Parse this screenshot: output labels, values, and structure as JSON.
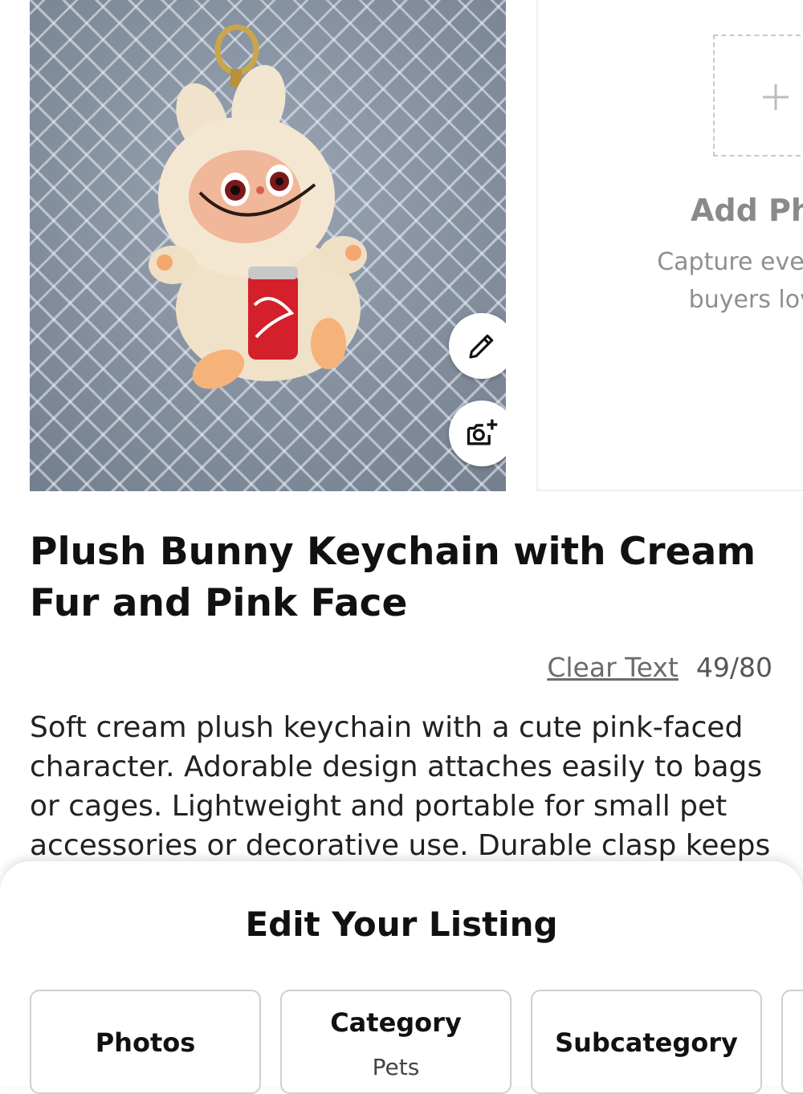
{
  "photos": {
    "edit_icon": "pencil-icon",
    "add_icon": "camera-plus-icon",
    "add_photo": {
      "title": "Add Pho",
      "subtitle_line1": "Capture every",
      "subtitle_line2": "buyers love"
    }
  },
  "listing": {
    "title": "Plush Bunny Keychain with Cream Fur and Pink Face",
    "clear_text": "Clear Text",
    "char_count": "49/80",
    "description": "Soft cream plush keychain with a cute pink-faced character. Adorable design attaches easily to bags or cages. Lightweight and portable for small pet accessories or decorative use. Durable clasp keeps"
  },
  "sheet": {
    "title": "Edit Your Listing",
    "chips": [
      {
        "label": "Photos",
        "value": ""
      },
      {
        "label": "Category",
        "value": "Pets"
      },
      {
        "label": "Subcategory",
        "value": ""
      }
    ]
  }
}
